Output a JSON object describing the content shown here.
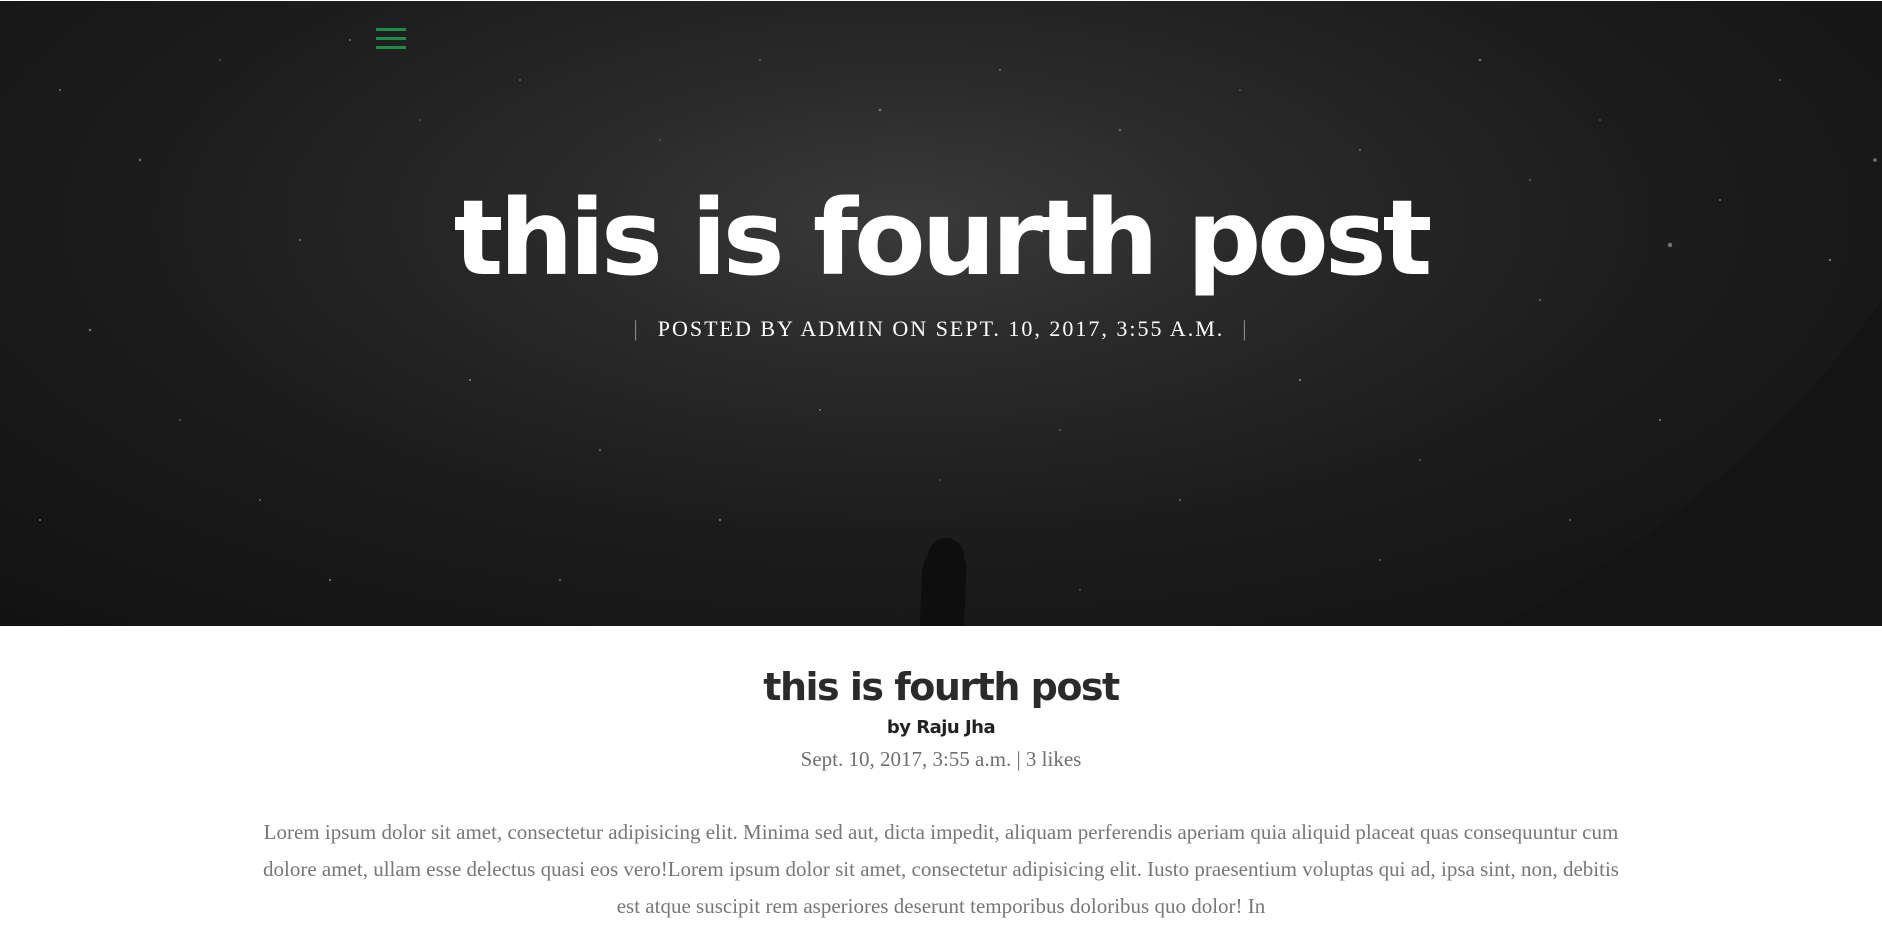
{
  "nav": {
    "menu_icon": "hamburger-menu-icon",
    "accent_color": "#1e8b46"
  },
  "hero": {
    "title": "this is fourth post",
    "meta": "POSTED BY ADMIN ON SEPT. 10, 2017, 3:55 A.M.",
    "separator": "|"
  },
  "post": {
    "title": "this is fourth post",
    "author": "by Raju Jha",
    "date_likes": "Sept. 10, 2017, 3:55 a.m. | 3 likes",
    "body": "Lorem ipsum dolor sit amet, consectetur adipisicing elit. Minima sed aut, dicta impedit, aliquam perferendis aperiam quia aliquid placeat quas consequuntur cum dolore amet, ullam esse delectus quasi eos vero!Lorem ipsum dolor sit amet, consectetur adipisicing elit. Iusto praesentium voluptas qui ad, ipsa sint, non, debitis est atque suscipit rem asperiores deserunt temporibus doloribus quo dolor! In"
  }
}
